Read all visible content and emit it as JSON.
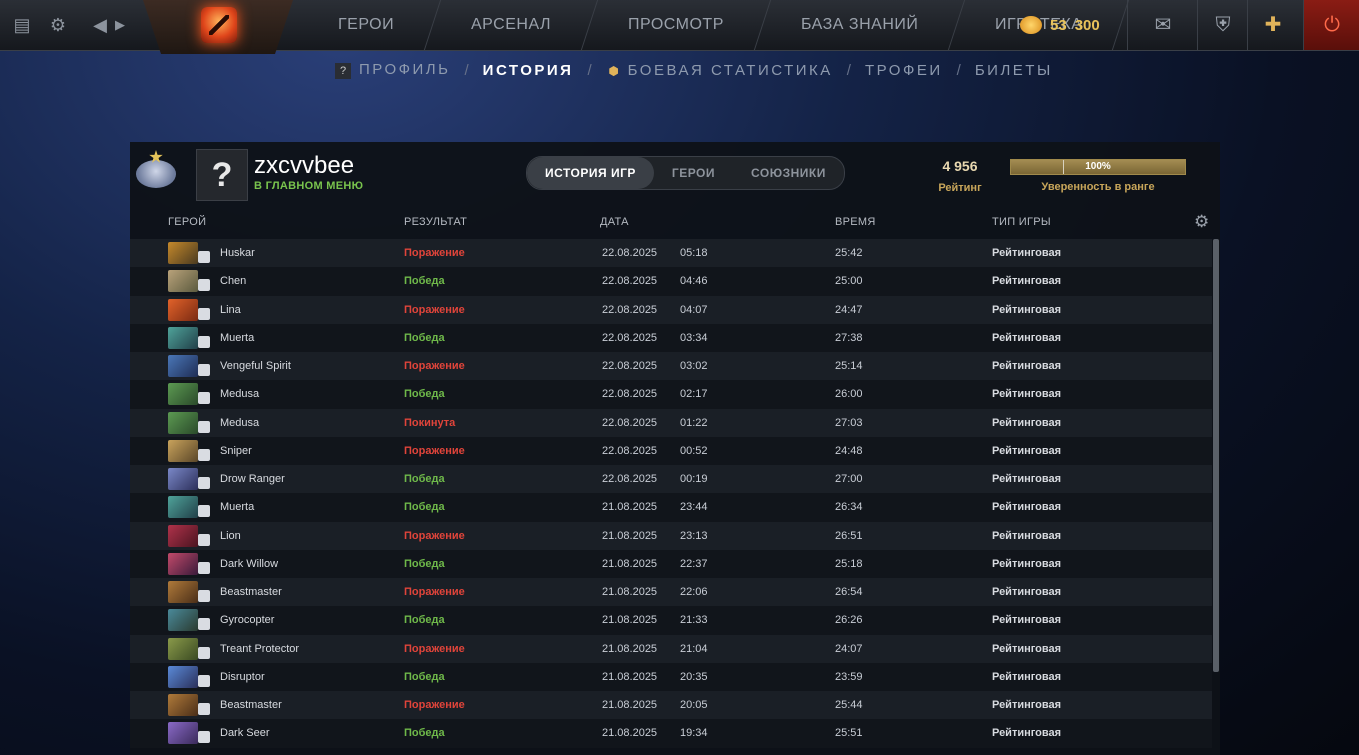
{
  "topbar": {
    "nav": [
      "ГЕРОИ",
      "АРСЕНАЛ",
      "ПРОСМОТР",
      "БАЗА ЗНАНИЙ",
      "ИГРОТЕКА"
    ],
    "currency_a": "53",
    "currency_b": "300"
  },
  "subnav": {
    "profile": "ПРОФИЛЬ",
    "history": "ИСТОРИЯ",
    "stats": "БОЕВАЯ СТАТИСТИКА",
    "trophies": "ТРОФЕИ",
    "tickets": "БИЛЕТЫ",
    "sep": "/"
  },
  "profile": {
    "avatar_glyph": "?",
    "username": "zxcvvbee",
    "status": "В ГЛАВНОМ МЕНЮ"
  },
  "tabs": [
    "ИСТОРИЯ ИГР",
    "ГЕРОИ",
    "СОЮЗНИКИ"
  ],
  "rating": {
    "value": "4 956",
    "label": "Рейтинг"
  },
  "confidence": {
    "percent_text": "100%",
    "fraction": 1.0,
    "label": "Уверенность в ранге"
  },
  "columns": {
    "hero": "ГЕРОЙ",
    "result": "РЕЗУЛЬТАТ",
    "date": "ДАТА",
    "duration": "ВРЕМЯ",
    "type": "ТИП ИГРЫ"
  },
  "colors": {
    "win": "#6fb94a",
    "loss": "#e0443a",
    "accent": "#c8a65a"
  },
  "matches": [
    {
      "hero": "Huskar",
      "result": "Поражение",
      "kind": "loss",
      "date": "22.08.2025",
      "time": "05:18",
      "duration": "25:42",
      "type": "Рейтинговая",
      "c1": "#c5892b",
      "c2": "#4a3a20"
    },
    {
      "hero": "Chen",
      "result": "Победа",
      "kind": "win",
      "date": "22.08.2025",
      "time": "04:46",
      "duration": "25:00",
      "type": "Рейтинговая",
      "c1": "#b9a27a",
      "c2": "#5b5a3e"
    },
    {
      "hero": "Lina",
      "result": "Поражение",
      "kind": "loss",
      "date": "22.08.2025",
      "time": "04:07",
      "duration": "24:47",
      "type": "Рейтинговая",
      "c1": "#e2622a",
      "c2": "#7a2a12"
    },
    {
      "hero": "Muerta",
      "result": "Победа",
      "kind": "win",
      "date": "22.08.2025",
      "time": "03:34",
      "duration": "27:38",
      "type": "Рейтинговая",
      "c1": "#4fa39a",
      "c2": "#213f48"
    },
    {
      "hero": "Vengeful Spirit",
      "result": "Поражение",
      "kind": "loss",
      "date": "22.08.2025",
      "time": "03:02",
      "duration": "25:14",
      "type": "Рейтинговая",
      "c1": "#4a77b8",
      "c2": "#1f2d55"
    },
    {
      "hero": "Medusa",
      "result": "Победа",
      "kind": "win",
      "date": "22.08.2025",
      "time": "02:17",
      "duration": "26:00",
      "type": "Рейтинговая",
      "c1": "#5c9a52",
      "c2": "#2a4a2a"
    },
    {
      "hero": "Medusa",
      "result": "Покинута",
      "kind": "aband",
      "date": "22.08.2025",
      "time": "01:22",
      "duration": "27:03",
      "type": "Рейтинговая",
      "c1": "#5c9a52",
      "c2": "#2a4a2a"
    },
    {
      "hero": "Sniper",
      "result": "Поражение",
      "kind": "loss",
      "date": "22.08.2025",
      "time": "00:52",
      "duration": "24:48",
      "type": "Рейтинговая",
      "c1": "#c9a35c",
      "c2": "#5a4628"
    },
    {
      "hero": "Drow Ranger",
      "result": "Победа",
      "kind": "win",
      "date": "22.08.2025",
      "time": "00:19",
      "duration": "27:00",
      "type": "Рейтинговая",
      "c1": "#7a88c8",
      "c2": "#2c2f5a"
    },
    {
      "hero": "Muerta",
      "result": "Победа",
      "kind": "win",
      "date": "21.08.2025",
      "time": "23:44",
      "duration": "26:34",
      "type": "Рейтинговая",
      "c1": "#4fa39a",
      "c2": "#213f48"
    },
    {
      "hero": "Lion",
      "result": "Поражение",
      "kind": "loss",
      "date": "21.08.2025",
      "time": "23:13",
      "duration": "26:51",
      "type": "Рейтинговая",
      "c1": "#b0324a",
      "c2": "#4a1420"
    },
    {
      "hero": "Dark Willow",
      "result": "Победа",
      "kind": "win",
      "date": "21.08.2025",
      "time": "22:37",
      "duration": "25:18",
      "type": "Рейтинговая",
      "c1": "#c24a6a",
      "c2": "#3a1a3a"
    },
    {
      "hero": "Beastmaster",
      "result": "Поражение",
      "kind": "loss",
      "date": "21.08.2025",
      "time": "22:06",
      "duration": "26:54",
      "type": "Рейтинговая",
      "c1": "#b07a3a",
      "c2": "#4a2e18"
    },
    {
      "hero": "Gyrocopter",
      "result": "Победа",
      "kind": "win",
      "date": "21.08.2025",
      "time": "21:33",
      "duration": "26:26",
      "type": "Рейтинговая",
      "c1": "#4a8a9a",
      "c2": "#2a3a30"
    },
    {
      "hero": "Treant Protector",
      "result": "Поражение",
      "kind": "loss",
      "date": "21.08.2025",
      "time": "21:04",
      "duration": "24:07",
      "type": "Рейтинговая",
      "c1": "#8a9a4a",
      "c2": "#3a4a22"
    },
    {
      "hero": "Disruptor",
      "result": "Победа",
      "kind": "win",
      "date": "21.08.2025",
      "time": "20:35",
      "duration": "23:59",
      "type": "Рейтинговая",
      "c1": "#5a8ad8",
      "c2": "#2a2f5a"
    },
    {
      "hero": "Beastmaster",
      "result": "Поражение",
      "kind": "loss",
      "date": "21.08.2025",
      "time": "20:05",
      "duration": "25:44",
      "type": "Рейтинговая",
      "c1": "#b07a3a",
      "c2": "#4a2e18"
    },
    {
      "hero": "Dark Seer",
      "result": "Победа",
      "kind": "win",
      "date": "21.08.2025",
      "time": "19:34",
      "duration": "25:51",
      "type": "Рейтинговая",
      "c1": "#8a6ac8",
      "c2": "#3a2a5a"
    }
  ]
}
